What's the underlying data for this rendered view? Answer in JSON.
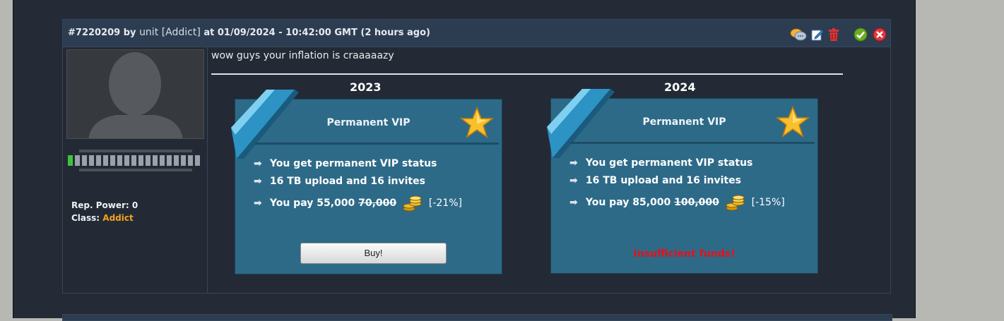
{
  "post": {
    "id": "#7220209",
    "by_label": "by",
    "username": "unit",
    "user_class_bracket": "[Addict]",
    "timestamp": "at 01/09/2024 - 10:42:00 GMT (2 hours ago)",
    "text": "wow guys your inflation is craaaaazy",
    "actions": [
      "quote-icon",
      "edit-icon",
      "delete-icon",
      "approve-icon",
      "close-icon"
    ]
  },
  "sidebar": {
    "rep_power_label": "Rep. Power:",
    "rep_power_value": "0",
    "class_label": "Class:",
    "class_value": "Addict",
    "reputation_level": 0.05
  },
  "cards": [
    {
      "year": "2023",
      "title": "Permanent VIP",
      "features": [
        "You get permanent VIP status",
        "16 TB upload and 16 invites"
      ],
      "pay_label": "You pay 55,000",
      "old_price": "70,000",
      "discount": "[-21%]",
      "button_label": "Buy!"
    },
    {
      "year": "2024",
      "title": "Permanent VIP",
      "features": [
        "You get permanent VIP status",
        "16 TB upload and 16 invites"
      ],
      "pay_label": "You pay 85,000",
      "old_price": "100,000",
      "discount": "[-15%]",
      "status": "Insufficient funds!"
    }
  ],
  "colors": {
    "background": "#242b36",
    "header": "#2c3d52",
    "card": "#2d6a88",
    "class_accent": "#f6a21b",
    "error": "#e8101a"
  }
}
